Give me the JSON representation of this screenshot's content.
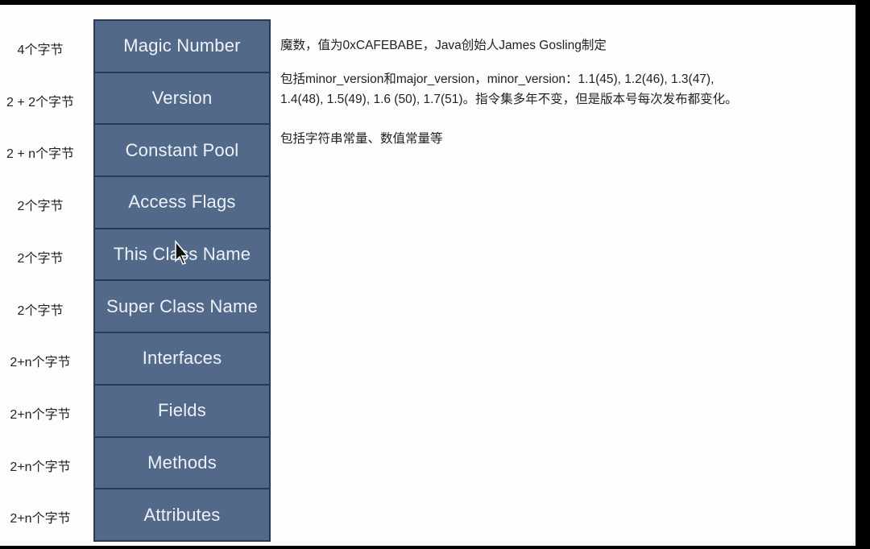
{
  "diagram": {
    "fields": [
      {
        "name": "Magic Number",
        "size": "4个字节"
      },
      {
        "name": "Version",
        "size": "2 + 2个字节"
      },
      {
        "name": "Constant Pool",
        "size": "2 + n个字节"
      },
      {
        "name": "Access Flags",
        "size": "2个字节"
      },
      {
        "name": "This Class Name",
        "size": "2个字节"
      },
      {
        "name": "Super Class Name",
        "size": "2个字节"
      },
      {
        "name": "Interfaces",
        "size": "2+n个字节"
      },
      {
        "name": "Fields",
        "size": "2+n个字节"
      },
      {
        "name": "Methods",
        "size": "2+n个字节"
      },
      {
        "name": "Attributes",
        "size": "2+n个字节"
      }
    ],
    "descriptions": {
      "magic": "魔数，值为0xCAFEBABE，Java创始人James Gosling制定",
      "version_line1": "包括minor_version和major_version，minor_version：1.1(45), 1.2(46), 1.3(47),",
      "version_line2": "1.4(48), 1.5(49), 1.6 (50), 1.7(51)。指令集多年不变，但是版本号每次发布都变化。",
      "constant_pool": "包括字符串常量、数值常量等"
    },
    "colors": {
      "box": "#52698a",
      "border": "#2a3a4f"
    }
  }
}
